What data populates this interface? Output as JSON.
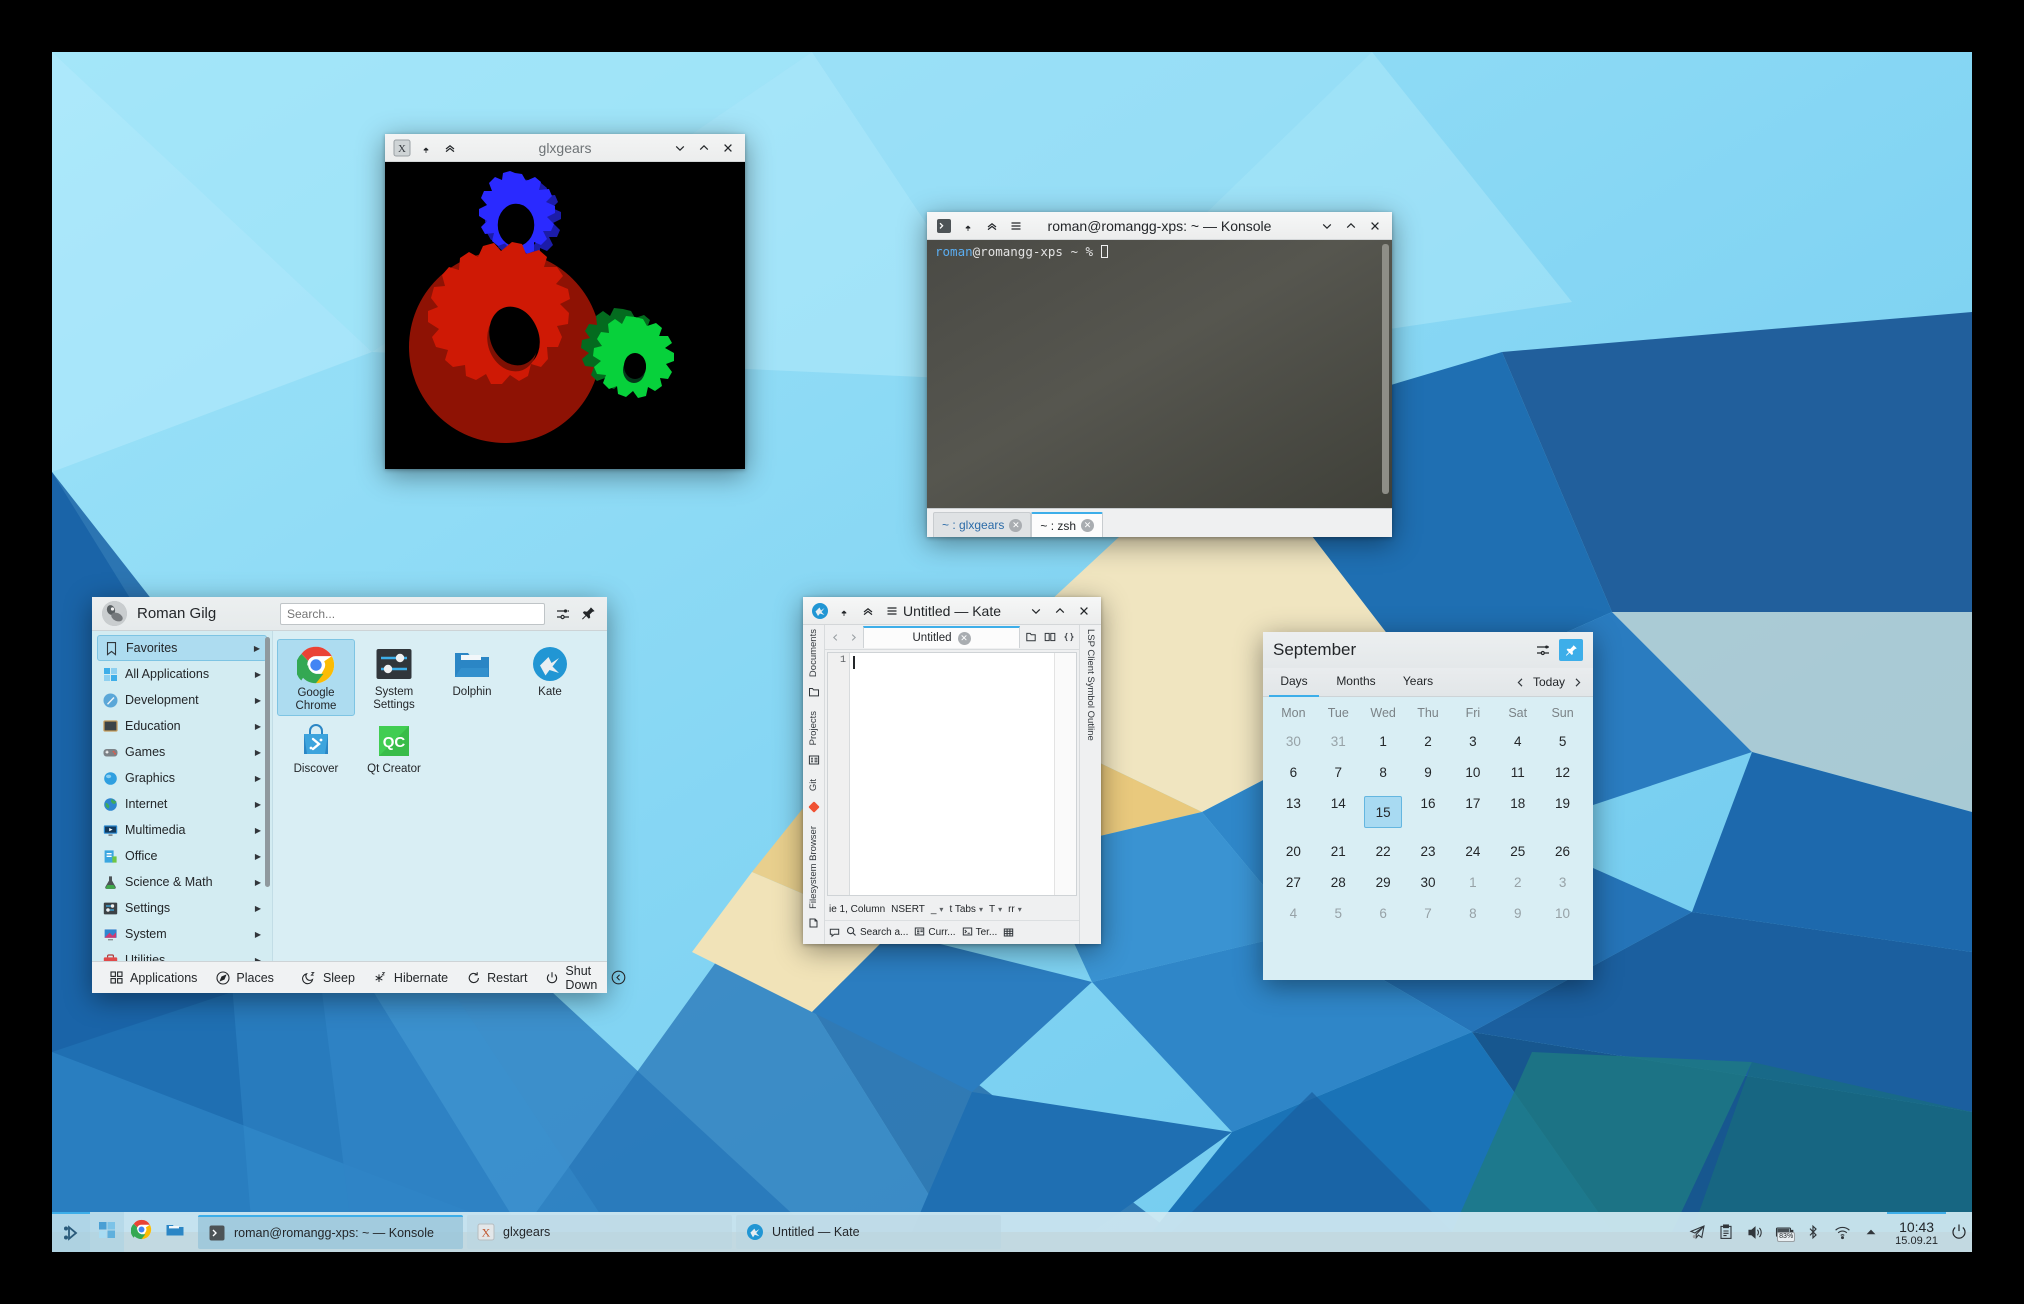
{
  "desktop": {
    "wallpaper_name": "plasma-geometric-wallpaper",
    "colors": {
      "sky_light": "#8fdcf7",
      "sky_pale": "#bdeefd",
      "blue_mid": "#2d7fc1",
      "blue_deep": "#1a5e9e",
      "blue_dark": "#174f86",
      "teal": "#1f7a7f",
      "sand": "#efd9a0",
      "cream": "#f2e9cf",
      "accent": "#3daee9"
    }
  },
  "glxgears": {
    "title": "glxgears",
    "icon_name": "x-application-icon",
    "buttons": {
      "pin": "keep-above-icon",
      "shade": "shade-icon",
      "minimize": "minimize-icon",
      "maximize": "maximize-icon",
      "close": "close-icon"
    },
    "gears": [
      {
        "name": "blue-gear",
        "color": "#2a2aff",
        "shade": "#1c1ca8",
        "teeth": 10
      },
      {
        "name": "red-gear",
        "color": "#cf1905",
        "shade": "#8e1204",
        "teeth": 20
      },
      {
        "name": "green-gear",
        "color": "#07d13b",
        "shade": "#046b1f",
        "teeth": 12
      }
    ]
  },
  "konsole": {
    "title": "roman@romangg-xps: ~ — Konsole",
    "icon_name": "konsole-icon",
    "prompt": {
      "user": "roman",
      "at_host": "@romangg-xps",
      "path": "~",
      "symbol": "%"
    },
    "tabs": [
      {
        "label": "~ : glxgears",
        "active": false
      },
      {
        "label": "~ : zsh",
        "active": true
      }
    ]
  },
  "kate": {
    "title": "Untitled — Kate",
    "icon_name": "kate-icon",
    "document_tab": "Untitled",
    "left_rail": [
      {
        "label": "Documents",
        "icon": "documents-icon"
      },
      {
        "label": "Projects",
        "icon": "projects-icon"
      },
      {
        "label": "Git",
        "icon": "git-icon"
      },
      {
        "label": "Filesystem Browser",
        "icon": "folder-icon"
      }
    ],
    "right_rail": [
      {
        "label": "LSP Client Symbol Outline",
        "icon": "outline-icon"
      }
    ],
    "toolbar_icons": [
      "new-file-icon",
      "split-view-icon",
      "brackets-icon"
    ],
    "line_numbers": [
      "1"
    ],
    "status": {
      "cursor": "ie 1, Column",
      "mode": "NSERT",
      "soft_tabs": "_",
      "indent": "t Tabs",
      "encoding": "T",
      "eol": "rr"
    },
    "bottom_bar": [
      {
        "label": "Search a...",
        "icon": "search-icon"
      },
      {
        "label": "Curr...",
        "icon": "document-icon"
      },
      {
        "label": "Ter...",
        "icon": "terminal-icon"
      },
      {
        "label": "",
        "icon": "grid-icon"
      }
    ]
  },
  "launcher": {
    "user_name": "Roman Gilg",
    "avatar_name": "user-avatar",
    "search": {
      "placeholder": "Search...",
      "value": ""
    },
    "head_icons": [
      {
        "name": "configure-icon"
      },
      {
        "name": "pin-icon"
      }
    ],
    "categories": [
      {
        "label": "Favorites",
        "icon": "bookmark-icon",
        "selected": true
      },
      {
        "label": "All Applications",
        "icon": "applications-grid-icon",
        "selected": false
      },
      {
        "label": "Development",
        "icon": "development-icon",
        "selected": false
      },
      {
        "label": "Education",
        "icon": "education-icon",
        "selected": false
      },
      {
        "label": "Games",
        "icon": "games-icon",
        "selected": false
      },
      {
        "label": "Graphics",
        "icon": "graphics-icon",
        "selected": false
      },
      {
        "label": "Internet",
        "icon": "internet-icon",
        "selected": false
      },
      {
        "label": "Multimedia",
        "icon": "multimedia-icon",
        "selected": false
      },
      {
        "label": "Office",
        "icon": "office-icon",
        "selected": false
      },
      {
        "label": "Science & Math",
        "icon": "science-icon",
        "selected": false
      },
      {
        "label": "Settings",
        "icon": "settings-icon",
        "selected": false
      },
      {
        "label": "System",
        "icon": "system-icon",
        "selected": false
      },
      {
        "label": "Utilities",
        "icon": "utilities-icon",
        "selected": false
      }
    ],
    "favorites": [
      {
        "label": "Google Chrome",
        "icon": "chrome-icon",
        "selected": true
      },
      {
        "label": "System Settings",
        "icon": "system-settings-icon",
        "selected": false
      },
      {
        "label": "Dolphin",
        "icon": "dolphin-icon",
        "selected": false
      },
      {
        "label": "Kate",
        "icon": "kate-icon",
        "selected": false
      },
      {
        "label": "Discover",
        "icon": "discover-icon",
        "selected": false
      },
      {
        "label": "Qt Creator",
        "icon": "qtcreator-icon",
        "selected": false
      }
    ],
    "footer": [
      {
        "label": "Applications",
        "icon": "applications-icon"
      },
      {
        "label": "Places",
        "icon": "places-icon"
      },
      {
        "label": "Sleep",
        "icon": "sleep-icon"
      },
      {
        "label": "Hibernate",
        "icon": "hibernate-icon"
      },
      {
        "label": "Restart",
        "icon": "restart-icon"
      },
      {
        "label": "Shut Down",
        "icon": "shutdown-icon"
      }
    ],
    "footer_collapse_icon": "collapse-icon"
  },
  "calendar": {
    "month": "September",
    "config_icon": "configure-icon",
    "pin_icon": "pin-icon",
    "tabs": [
      {
        "label": "Days",
        "active": true
      },
      {
        "label": "Months",
        "active": false
      },
      {
        "label": "Years",
        "active": false
      }
    ],
    "today_label": "Today",
    "prev_icon": "chevron-left-icon",
    "next_icon": "chevron-right-icon",
    "day_headers": [
      "Mon",
      "Tue",
      "Wed",
      "Thu",
      "Fri",
      "Sat",
      "Sun"
    ],
    "weeks": [
      [
        {
          "d": "30",
          "dim": true
        },
        {
          "d": "31",
          "dim": true
        },
        {
          "d": "1"
        },
        {
          "d": "2"
        },
        {
          "d": "3"
        },
        {
          "d": "4"
        },
        {
          "d": "5"
        }
      ],
      [
        {
          "d": "6"
        },
        {
          "d": "7"
        },
        {
          "d": "8"
        },
        {
          "d": "9"
        },
        {
          "d": "10"
        },
        {
          "d": "11"
        },
        {
          "d": "12"
        }
      ],
      [
        {
          "d": "13"
        },
        {
          "d": "14"
        },
        {
          "d": "15",
          "today": true
        },
        {
          "d": "16"
        },
        {
          "d": "17"
        },
        {
          "d": "18"
        },
        {
          "d": "19"
        }
      ],
      [
        {
          "d": "20"
        },
        {
          "d": "21"
        },
        {
          "d": "22"
        },
        {
          "d": "23"
        },
        {
          "d": "24"
        },
        {
          "d": "25"
        },
        {
          "d": "26"
        }
      ],
      [
        {
          "d": "27"
        },
        {
          "d": "28"
        },
        {
          "d": "29"
        },
        {
          "d": "30"
        },
        {
          "d": "1",
          "dim": true
        },
        {
          "d": "2",
          "dim": true
        },
        {
          "d": "3",
          "dim": true
        }
      ],
      [
        {
          "d": "4",
          "dim": true
        },
        {
          "d": "5",
          "dim": true
        },
        {
          "d": "6",
          "dim": true
        },
        {
          "d": "7",
          "dim": true
        },
        {
          "d": "8",
          "dim": true
        },
        {
          "d": "9",
          "dim": true
        },
        {
          "d": "10",
          "dim": true
        }
      ]
    ]
  },
  "panel": {
    "kickoff_icon": "kickoff-launcher-icon",
    "quick_launchers": [
      {
        "name": "show-desktop-icon"
      },
      {
        "name": "chrome-icon"
      },
      {
        "name": "dolphin-icon"
      }
    ],
    "tasks": [
      {
        "label": "roman@romangg-xps: ~ — Konsole",
        "icon": "konsole-icon",
        "active": true
      },
      {
        "label": "glxgears",
        "icon": "x-application-icon",
        "active": false
      },
      {
        "label": "Untitled — Kate",
        "icon": "kate-icon",
        "active": false
      }
    ],
    "tray": [
      {
        "name": "telegram-icon"
      },
      {
        "name": "clipboard-icon"
      },
      {
        "name": "volume-icon"
      },
      {
        "name": "battery-icon",
        "badge": "83%"
      },
      {
        "name": "bluetooth-icon"
      },
      {
        "name": "wifi-icon"
      },
      {
        "name": "tray-expand-arrow-icon"
      }
    ],
    "clock": {
      "time": "10:43",
      "date": "15.09.21"
    },
    "power_icon": "power-icon"
  }
}
